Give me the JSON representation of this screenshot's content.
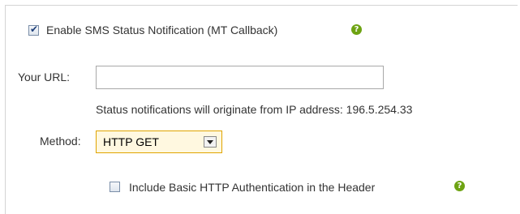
{
  "sms_callback": {
    "enable_checked": true,
    "enable_label": "Enable SMS Status Notification (MT Callback)",
    "help_glyph": "?",
    "url_label": "Your URL:",
    "url_value": "",
    "url_placeholder": "",
    "ip_notice": "Status notifications will originate from IP address: 196.5.254.33",
    "method_label": "Method:",
    "method_value": "HTTP GET",
    "auth_checked": false,
    "auth_label": "Include Basic HTTP Authentication in the Header"
  },
  "colors": {
    "help_icon": "#6ea313",
    "select_border": "#e0a400"
  },
  "icons": [
    "checkbox-icon",
    "help-icon",
    "chevron-down-icon"
  ]
}
